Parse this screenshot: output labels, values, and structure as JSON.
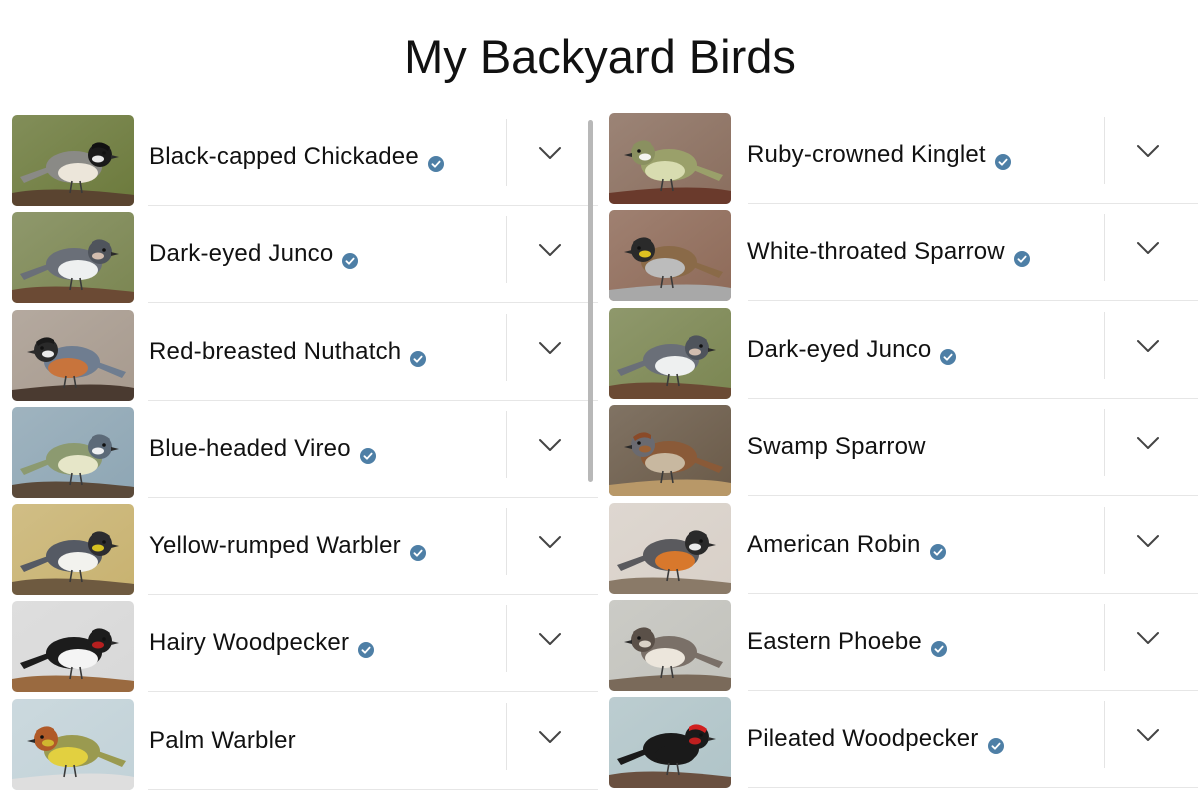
{
  "header": {
    "title": "My Backyard Birds"
  },
  "colors": {
    "verified_badge": "#4e7fa6",
    "chevron": "#444444",
    "divider": "#e6e6e6"
  },
  "left_column": [
    {
      "name": "Black-capped Chickadee",
      "verified": true,
      "photo": "chickadee"
    },
    {
      "name": "Dark-eyed Junco",
      "verified": true,
      "photo": "junco"
    },
    {
      "name": "Red-breasted Nuthatch",
      "verified": true,
      "photo": "nuthatch"
    },
    {
      "name": "Blue-headed Vireo",
      "verified": true,
      "photo": "vireo"
    },
    {
      "name": "Yellow-rumped Warbler",
      "verified": true,
      "photo": "warbler-yellow-rumped"
    },
    {
      "name": "Hairy Woodpecker",
      "verified": true,
      "photo": "woodpecker-hairy"
    },
    {
      "name": "Palm Warbler",
      "verified": false,
      "photo": "warbler-palm"
    }
  ],
  "right_column": [
    {
      "name": "Ruby-crowned Kinglet",
      "verified": true,
      "photo": "kinglet"
    },
    {
      "name": "White-throated Sparrow",
      "verified": true,
      "photo": "sparrow-white-throated"
    },
    {
      "name": "Dark-eyed Junco",
      "verified": true,
      "photo": "junco"
    },
    {
      "name": "Swamp Sparrow",
      "verified": false,
      "photo": "sparrow-swamp"
    },
    {
      "name": "American Robin",
      "verified": true,
      "photo": "robin"
    },
    {
      "name": "Eastern Phoebe",
      "verified": true,
      "photo": "phoebe"
    },
    {
      "name": "Pileated Woodpecker",
      "verified": true,
      "photo": "woodpecker-pileated"
    }
  ],
  "icons": {
    "expand": "chevron-down-icon",
    "verified": "verified-badge-icon"
  }
}
